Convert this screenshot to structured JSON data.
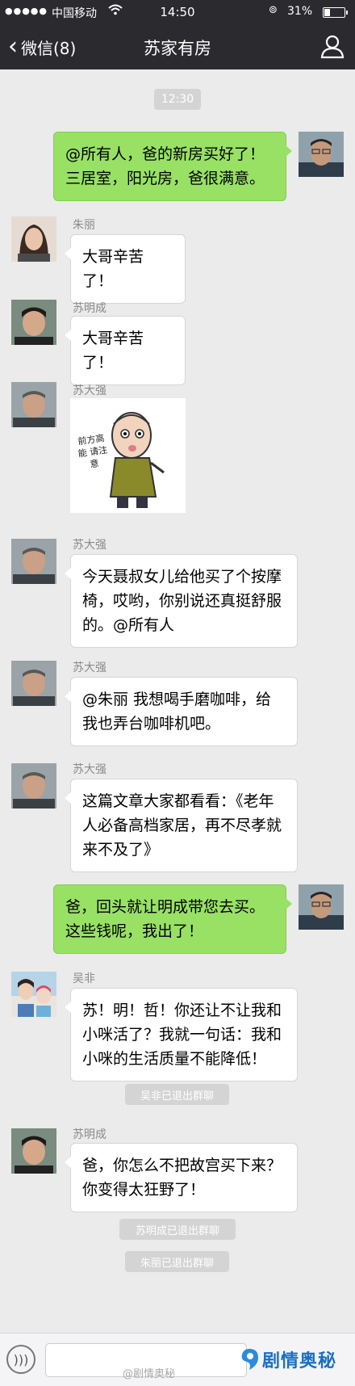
{
  "status_bar": {
    "carrier": "中国移动",
    "time": "14:50",
    "battery": "31%",
    "battery_level": 0.31
  },
  "nav": {
    "back_label": "微信(8)",
    "title": "苏家有房"
  },
  "chat": {
    "timestamp": "12:30",
    "messages": [
      {
        "sender": "",
        "text_lines": [
          "@所有人，爸的新房买好了！",
          "三居室，阳光房，爸很满意。"
        ],
        "side": "right"
      },
      {
        "sender": "朱丽",
        "text_lines": [
          "大哥辛苦了！"
        ],
        "side": "left"
      },
      {
        "sender": "苏明成",
        "text_lines": [
          "大哥辛苦了！"
        ],
        "side": "left"
      },
      {
        "sender": "苏大强",
        "sticker_text": "前方高能 请注意",
        "side": "left"
      },
      {
        "sender": "苏大强",
        "text_lines": [
          "今天聂叔女儿给他买了个按摩",
          "椅，哎哟，你别说还真挺舒服",
          "的。@所有人"
        ],
        "side": "left"
      },
      {
        "sender": "苏大强",
        "text_lines": [
          "@朱丽 我想喝手磨咖啡，给",
          "我也弄台咖啡机吧。"
        ],
        "side": "left"
      },
      {
        "sender": "苏大强",
        "text_lines": [
          "这篇文章大家都看看：《老年",
          "人必备高档家居，再不尽孝就",
          "来不及了》"
        ],
        "side": "left"
      },
      {
        "sender": "",
        "text_lines": [
          "爸，回头就让明成带您去买。",
          "这些钱呢，我出了！"
        ],
        "side": "right"
      },
      {
        "sender": "吴非",
        "text_lines": [
          "苏！明！哲！你还让不让我和",
          "小咪活了？我就一句话：我和",
          "小咪的生活质量不能降低！"
        ],
        "side": "left"
      },
      {
        "sender": "苏明成",
        "text_lines": [
          "爸，你怎么不把故宫买下来？",
          "你变得太狂野了！"
        ],
        "side": "left"
      }
    ],
    "system_notices": [
      "吴非已退出群聊",
      "苏明成已退出群聊",
      "朱丽已退出群聊"
    ]
  },
  "watermark": {
    "left": "@剧情奥秘",
    "brand": "剧情奥秘"
  }
}
